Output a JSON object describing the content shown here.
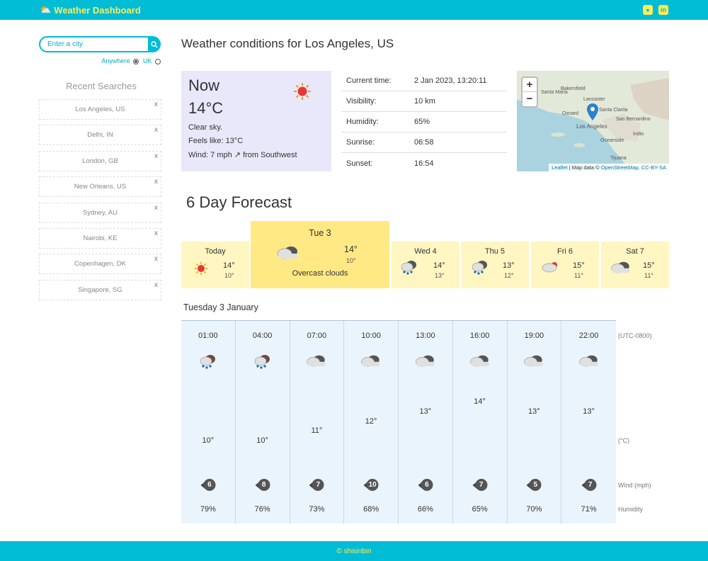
{
  "header": {
    "title": "Weather Dashboard",
    "github": "github-icon",
    "linkedin": "linkedin-icon"
  },
  "sidebar": {
    "search_placeholder": "Enter a city",
    "scope_anywhere": "Anywhere",
    "scope_uk": "UK",
    "recent_title": "Recent Searches",
    "recent": [
      "Los Angeles, US",
      "Delhi, IN",
      "London, GB",
      "New Orleans, US",
      "Sydney, AU",
      "Nairobi, KE",
      "Copenhagen, DK",
      "Singapore, SG"
    ],
    "close": "x"
  },
  "main": {
    "title": "Weather conditions for Los Angeles, US"
  },
  "now": {
    "label": "Now",
    "temp": "14°C",
    "desc": "Clear sky.",
    "feels": "Feels like: 13°C",
    "wind": "Wind: 7 mph ↗ from Southwest"
  },
  "details": [
    {
      "k": "Current time:",
      "v": "2 Jan 2023, 13:20:11"
    },
    {
      "k": "Visibility:",
      "v": "10 km"
    },
    {
      "k": "Humidity:",
      "v": "65%"
    },
    {
      "k": "Sunrise:",
      "v": "06:58"
    },
    {
      "k": "Sunset:",
      "v": "16:54"
    }
  ],
  "map": {
    "zoom_in": "+",
    "zoom_out": "−",
    "labels": [
      "Santa Maria",
      "Bakersfield",
      "Lancaster",
      "Santa Clarita",
      "Oxnard",
      "San Bernardino",
      "Los Angeles",
      "Indio",
      "Oceanside",
      "Tijuana"
    ],
    "attr_leaflet": "Leaflet",
    "attr_text": " | Map data © ",
    "attr_osm": "OpenStreetMap, CC-BY-SA"
  },
  "forecast": {
    "title": "6 Day Forecast",
    "days": [
      {
        "name": "Today",
        "hi": "14°",
        "lo": "10°"
      },
      {
        "name": "Tue 3",
        "hi": "14°",
        "lo": "10°",
        "desc": "Overcast clouds"
      },
      {
        "name": "Wed 4",
        "hi": "14°",
        "lo": "13°"
      },
      {
        "name": "Thu 5",
        "hi": "13°",
        "lo": "12°"
      },
      {
        "name": "Fri 6",
        "hi": "15°",
        "lo": "11°"
      },
      {
        "name": "Sat 7",
        "hi": "15°",
        "lo": "11°"
      }
    ]
  },
  "hourly": {
    "title": "Tuesday 3 January",
    "tz_label": "(UTC-0800)",
    "temp_label": "(°C)",
    "wind_label": "Wind (mph)",
    "humidity_label": "Humidity",
    "hours": [
      {
        "time": "01:00",
        "temp": "10°",
        "wind": "6",
        "hum": "79%"
      },
      {
        "time": "04:00",
        "temp": "10°",
        "wind": "8",
        "hum": "76%"
      },
      {
        "time": "07:00",
        "temp": "11°",
        "wind": "7",
        "hum": "73%"
      },
      {
        "time": "10:00",
        "temp": "12°",
        "wind": "10",
        "hum": "68%"
      },
      {
        "time": "13:00",
        "temp": "13°",
        "wind": "6",
        "hum": "66%"
      },
      {
        "time": "16:00",
        "temp": "14°",
        "wind": "7",
        "hum": "65%"
      },
      {
        "time": "19:00",
        "temp": "13°",
        "wind": "5",
        "hum": "70%"
      },
      {
        "time": "22:00",
        "temp": "13°",
        "wind": "7",
        "hum": "71%"
      }
    ]
  },
  "footer": {
    "text": "© shisinbin"
  },
  "colors": {
    "accent": "#00bcd4",
    "brand_text": "#ffee58",
    "now_bg": "#e8e8fa",
    "forecast_bg": "#fff6c2",
    "forecast_active": "#ffe985",
    "hourly_bg": "#eaf4fc"
  }
}
